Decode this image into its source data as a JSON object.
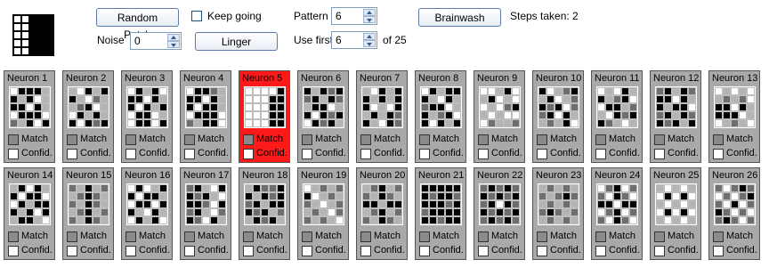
{
  "controls": {
    "random_patch_label": "Random Patch",
    "keep_going_label": "Keep going",
    "pattern_label": "Pattern",
    "pattern_value": "6",
    "brainwash_label": "Brainwash",
    "steps_text": "Steps taken: 2",
    "noise_label": "Noise",
    "noise_value": "0",
    "linger_label": "Linger",
    "use_first_label": "Use first",
    "use_first_value": "6",
    "of_total_text": "of 25"
  },
  "pattern_preview": {
    "cells": [
      0,
      0,
      1,
      1,
      1,
      0,
      0,
      1,
      1,
      1,
      0,
      0,
      1,
      1,
      1,
      0,
      0,
      1,
      1,
      1,
      0,
      0,
      1,
      1,
      1
    ]
  },
  "colors": {
    "active_neuron": "#ff1a1a",
    "neuron_bg": "#a9a9a9"
  },
  "neuron_row_labels": {
    "match": "Match",
    "confid": "Confid."
  },
  "active_neuron_index": 4,
  "neurons": [
    {
      "name": "Neuron 1",
      "cells": [
        0,
        3,
        3,
        3,
        1,
        3,
        1,
        3,
        0,
        1,
        3,
        3,
        0,
        3,
        1,
        0,
        3,
        3,
        3,
        0,
        2,
        1,
        3,
        0,
        3
      ]
    },
    {
      "name": "Neuron 2",
      "cells": [
        1,
        0,
        3,
        1,
        3,
        3,
        1,
        0,
        2,
        1,
        1,
        2,
        3,
        0,
        1,
        0,
        3,
        1,
        3,
        1,
        3,
        0,
        3,
        2,
        3
      ]
    },
    {
      "name": "Neuron 3",
      "cells": [
        0,
        3,
        1,
        3,
        0,
        3,
        3,
        0,
        3,
        1,
        3,
        0,
        3,
        1,
        3,
        0,
        3,
        3,
        0,
        1,
        0,
        3,
        3,
        0,
        3
      ]
    },
    {
      "name": "Neuron 4",
      "cells": [
        0,
        3,
        3,
        2,
        1,
        3,
        3,
        0,
        3,
        1,
        3,
        0,
        3,
        3,
        1,
        0,
        3,
        3,
        3,
        0,
        2,
        1,
        3,
        3,
        0
      ]
    },
    {
      "name": "Neuron 5",
      "cells": [
        0,
        0,
        0,
        0,
        3,
        0,
        0,
        0,
        3,
        3,
        0,
        0,
        0,
        3,
        3,
        0,
        0,
        0,
        3,
        3,
        0,
        0,
        0,
        3,
        3
      ]
    },
    {
      "name": "Neuron 6",
      "cells": [
        3,
        1,
        3,
        2,
        3,
        2,
        3,
        1,
        3,
        2,
        1,
        3,
        3,
        0,
        1,
        3,
        0,
        3,
        2,
        3,
        0,
        3,
        2,
        3,
        1
      ]
    },
    {
      "name": "Neuron 7",
      "cells": [
        1,
        0,
        3,
        1,
        3,
        3,
        1,
        3,
        1,
        3,
        3,
        0,
        1,
        0,
        3,
        1,
        3,
        1,
        3,
        2,
        3,
        1,
        0,
        3,
        2
      ]
    },
    {
      "name": "Neuron 8",
      "cells": [
        0,
        3,
        1,
        3,
        3,
        3,
        1,
        0,
        3,
        1,
        2,
        3,
        3,
        0,
        1,
        3,
        1,
        2,
        3,
        0,
        3,
        0,
        3,
        1,
        3
      ]
    },
    {
      "name": "Neuron 9",
      "cells": [
        0,
        0,
        1,
        3,
        0,
        1,
        3,
        0,
        1,
        0,
        0,
        1,
        0,
        2,
        3,
        1,
        0,
        1,
        0,
        0,
        0,
        2,
        1,
        1,
        2
      ]
    },
    {
      "name": "Neuron 10",
      "cells": [
        3,
        0,
        1,
        2,
        3,
        1,
        3,
        0,
        1,
        2,
        3,
        2,
        3,
        0,
        2,
        2,
        3,
        0,
        3,
        1,
        1,
        2,
        1,
        3,
        0
      ]
    },
    {
      "name": "Neuron 11",
      "cells": [
        0,
        1,
        0,
        3,
        1,
        3,
        1,
        2,
        3,
        0,
        0,
        3,
        3,
        1,
        2,
        1,
        0,
        3,
        2,
        3,
        3,
        2,
        1,
        0,
        1
      ]
    },
    {
      "name": "Neuron 12",
      "cells": [
        2,
        3,
        1,
        3,
        2,
        3,
        3,
        0,
        3,
        1,
        3,
        1,
        3,
        3,
        0,
        2,
        3,
        1,
        3,
        2,
        3,
        2,
        3,
        1,
        3
      ]
    },
    {
      "name": "Neuron 13",
      "cells": [
        0,
        1,
        0,
        1,
        0,
        1,
        2,
        1,
        2,
        0,
        3,
        3,
        0,
        3,
        1,
        3,
        3,
        3,
        0,
        1,
        0,
        1,
        2,
        1,
        0
      ]
    },
    {
      "name": "Neuron 14",
      "cells": [
        1,
        3,
        0,
        3,
        1,
        3,
        0,
        3,
        3,
        0,
        0,
        3,
        1,
        3,
        3,
        3,
        1,
        3,
        0,
        3,
        1,
        3,
        3,
        1,
        0
      ]
    },
    {
      "name": "Neuron 15",
      "cells": [
        2,
        1,
        3,
        1,
        2,
        1,
        2,
        3,
        2,
        1,
        2,
        1,
        3,
        2,
        1,
        1,
        2,
        3,
        1,
        2,
        2,
        1,
        3,
        2,
        1
      ]
    },
    {
      "name": "Neuron 16",
      "cells": [
        0,
        3,
        0,
        1,
        3,
        3,
        0,
        3,
        3,
        1,
        0,
        3,
        3,
        0,
        3,
        3,
        1,
        0,
        3,
        1,
        0,
        3,
        1,
        3,
        0
      ]
    },
    {
      "name": "Neuron 17",
      "cells": [
        2,
        3,
        1,
        0,
        3,
        3,
        2,
        3,
        1,
        0,
        3,
        3,
        2,
        0,
        3,
        2,
        3,
        1,
        0,
        2,
        3,
        2,
        0,
        3,
        1
      ]
    },
    {
      "name": "Neuron 18",
      "cells": [
        1,
        3,
        2,
        2,
        3,
        3,
        1,
        3,
        2,
        3,
        2,
        3,
        1,
        3,
        3,
        3,
        2,
        3,
        1,
        2,
        1,
        3,
        2,
        3,
        1
      ]
    },
    {
      "name": "Neuron 19",
      "cells": [
        0,
        1,
        2,
        1,
        2,
        3,
        0,
        1,
        2,
        1,
        2,
        1,
        0,
        1,
        2,
        1,
        2,
        1,
        0,
        2,
        2,
        1,
        2,
        1,
        0
      ]
    },
    {
      "name": "Neuron 20",
      "cells": [
        1,
        2,
        3,
        1,
        2,
        2,
        1,
        3,
        2,
        1,
        3,
        3,
        1,
        3,
        3,
        1,
        2,
        3,
        1,
        2,
        2,
        1,
        3,
        2,
        1
      ]
    },
    {
      "name": "Neuron 21",
      "cells": [
        3,
        3,
        3,
        3,
        3,
        3,
        2,
        3,
        3,
        2,
        3,
        3,
        3,
        2,
        3,
        2,
        3,
        3,
        3,
        3,
        3,
        3,
        2,
        3,
        3
      ]
    },
    {
      "name": "Neuron 22",
      "cells": [
        2,
        3,
        2,
        3,
        2,
        3,
        2,
        3,
        2,
        3,
        2,
        3,
        0,
        3,
        2,
        3,
        2,
        3,
        2,
        3,
        2,
        3,
        2,
        3,
        2
      ]
    },
    {
      "name": "Neuron 23",
      "cells": [
        1,
        2,
        1,
        2,
        1,
        2,
        1,
        2,
        3,
        2,
        1,
        2,
        1,
        2,
        1,
        2,
        3,
        2,
        1,
        2,
        1,
        2,
        1,
        2,
        1
      ]
    },
    {
      "name": "Neuron 24",
      "cells": [
        0,
        2,
        3,
        0,
        2,
        2,
        0,
        3,
        2,
        0,
        3,
        3,
        0,
        3,
        3,
        0,
        2,
        3,
        0,
        2,
        2,
        0,
        3,
        2,
        0
      ]
    },
    {
      "name": "Neuron 25",
      "cells": [
        1,
        0,
        1,
        0,
        1,
        0,
        3,
        0,
        3,
        0,
        1,
        0,
        1,
        0,
        1,
        0,
        3,
        0,
        3,
        0,
        1,
        0,
        1,
        0,
        1
      ]
    },
    {
      "name": "Neuron 26",
      "cells": [
        2,
        0,
        2,
        3,
        2,
        0,
        2,
        0,
        2,
        3,
        2,
        0,
        3,
        0,
        2,
        3,
        2,
        0,
        2,
        0,
        2,
        3,
        2,
        0,
        2
      ]
    }
  ]
}
